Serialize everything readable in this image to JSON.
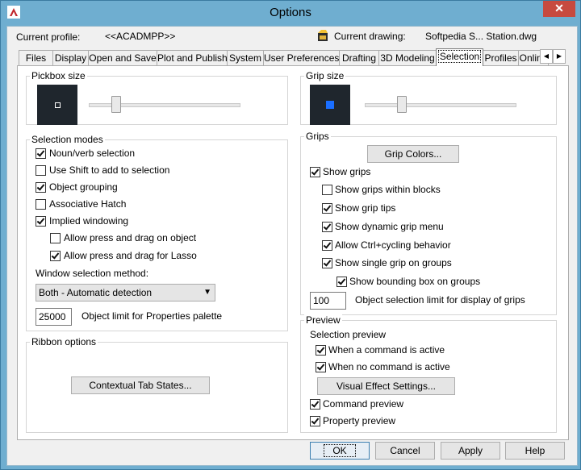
{
  "window": {
    "title": "Options"
  },
  "header": {
    "current_profile_label": "Current profile:",
    "current_profile_value": "<<ACADMPP>>",
    "current_drawing_label": "Current drawing:",
    "current_drawing_value": "Softpedia S... Station.dwg"
  },
  "tabs": [
    "Files",
    "Display",
    "Open and Save",
    "Plot and Publish",
    "System",
    "User Preferences",
    "Drafting",
    "3D Modeling",
    "Selection",
    "Profiles",
    "Online"
  ],
  "active_tab": "Selection",
  "pickbox": {
    "title": "Pickbox size",
    "level": 0.16
  },
  "grip_size": {
    "title": "Grip size",
    "level": 0.23,
    "preview_color": "#1a6eff"
  },
  "selection_modes": {
    "title": "Selection modes",
    "noun_verb": {
      "label": "Noun/verb selection",
      "checked": true
    },
    "use_shift": {
      "label": "Use Shift to add to selection",
      "checked": false
    },
    "object_grouping": {
      "label": "Object grouping",
      "checked": true
    },
    "associative_hatch": {
      "label": "Associative Hatch",
      "checked": false
    },
    "implied_windowing": {
      "label": "Implied windowing",
      "checked": true
    },
    "press_drag_object": {
      "label": "Allow press and drag on object",
      "checked": false
    },
    "press_drag_lasso": {
      "label": "Allow press and drag for Lasso",
      "checked": true
    },
    "window_method_label": "Window selection method:",
    "window_method_value": "Both - Automatic detection",
    "object_limit_value": "25000",
    "object_limit_label": "Object limit for Properties palette"
  },
  "ribbon": {
    "title": "Ribbon options",
    "contextual_button": "Contextual Tab States..."
  },
  "grips": {
    "title": "Grips",
    "grip_colors_button": "Grip Colors...",
    "show_grips": {
      "label": "Show grips",
      "checked": true
    },
    "within_blocks": {
      "label": "Show grips within blocks",
      "checked": false
    },
    "grip_tips": {
      "label": "Show grip tips",
      "checked": true
    },
    "dynamic_menu": {
      "label": "Show dynamic grip menu",
      "checked": true
    },
    "ctrl_cycling": {
      "label": "Allow Ctrl+cycling behavior",
      "checked": true
    },
    "single_grip": {
      "label": "Show single grip on groups",
      "checked": true
    },
    "bounding_box": {
      "label": "Show bounding box on groups",
      "checked": true
    },
    "limit_value": "100",
    "limit_label": "Object selection limit for display of grips"
  },
  "preview": {
    "title": "Preview",
    "selection_preview_label": "Selection preview",
    "when_active": {
      "label": "When a command is active",
      "checked": true
    },
    "when_no_command": {
      "label": "When no command is active",
      "checked": true
    },
    "visual_effect_button": "Visual Effect Settings...",
    "command_preview": {
      "label": "Command preview",
      "checked": true
    },
    "property_preview": {
      "label": "Property preview",
      "checked": true
    }
  },
  "footer": {
    "ok": "OK",
    "cancel": "Cancel",
    "apply": "Apply",
    "help": "Help"
  }
}
